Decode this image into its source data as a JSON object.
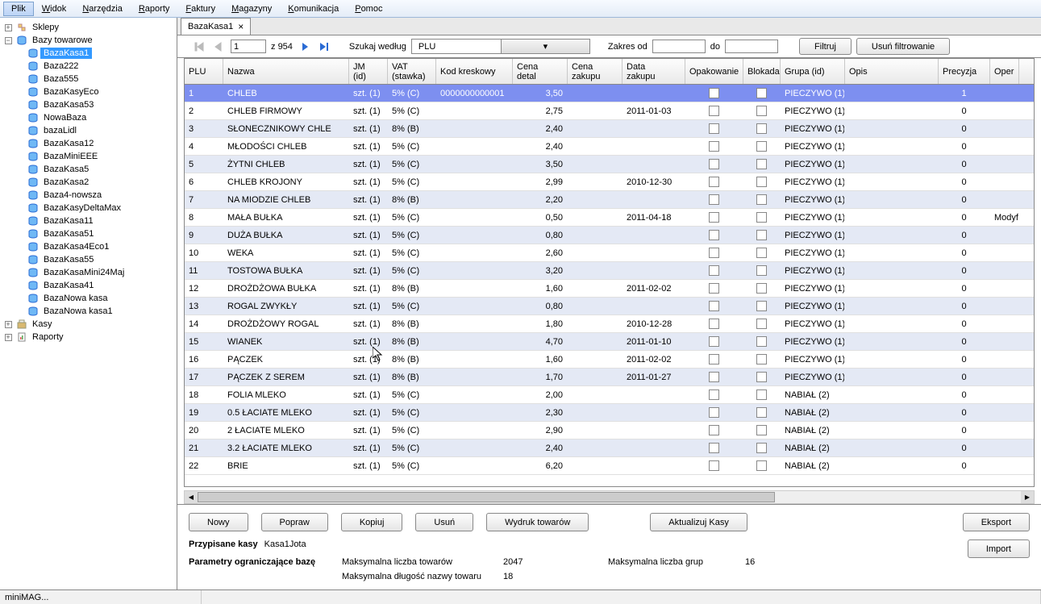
{
  "menu": [
    "Plik",
    "Widok",
    "Narzędzia",
    "Raporty",
    "Faktury",
    "Magazyny",
    "Komunikacja",
    "Pomoc"
  ],
  "tree": {
    "roots": [
      {
        "label": "Sklepy",
        "icon": "shops",
        "exp": "+"
      },
      {
        "label": "Bazy towarowe",
        "icon": "db",
        "exp": "-",
        "children": [
          "BazaKasa1",
          "Baza222",
          "Baza555",
          "BazaKasyEco",
          "BazaKasa53",
          "NowaBaza",
          "bazaLidl",
          "BazaKasa12",
          "BazaMiniEEE",
          "BazaKasa5",
          "BazaKasa2",
          "Baza4-nowsza",
          "BazaKasyDeltaMax",
          "BazaKasa11",
          "BazaKasa51",
          "BazaKasa4Eco1",
          "BazaKasa55",
          "BazaKasaMini24Maj",
          "BazaKasa41",
          "BazaNowa kasa",
          "BazaNowa kasa1"
        ],
        "selected": "BazaKasa1"
      },
      {
        "label": "Kasy",
        "icon": "register",
        "exp": "+"
      },
      {
        "label": "Raporty",
        "icon": "report",
        "exp": "+"
      }
    ]
  },
  "tab": {
    "label": "BazaKasa1"
  },
  "toolbar": {
    "page": "1",
    "of_prefix": "z",
    "of": "954",
    "search_label": "Szukaj według",
    "search_field": "PLU",
    "range_from_label": "Zakres od",
    "range_to_label": "do",
    "range_from": "",
    "range_to": "",
    "filter_btn": "Filtruj",
    "clear_btn": "Usuń filtrowanie"
  },
  "columns": [
    "PLU",
    "Nazwa",
    "JM (id)",
    "VAT (stawka)",
    "Kod kreskowy",
    "Cena detal",
    "Cena zakupu",
    "Data zakupu",
    "Opakowanie",
    "Blokada",
    "Grupa (id)",
    "Opis",
    "Precyzja",
    "Oper"
  ],
  "rows": [
    {
      "plu": "1",
      "name": "CHLEB",
      "jm": "szt. (1)",
      "vat": "5% (C)",
      "bar": "0000000000001",
      "cd": "3,50",
      "cz": "",
      "dz": "",
      "grp": "PIECZYWO (1)",
      "pr": "1",
      "op": "",
      "sel": true
    },
    {
      "plu": "2",
      "name": "CHLEB FIRMOWY",
      "jm": "szt. (1)",
      "vat": "5% (C)",
      "bar": "",
      "cd": "2,75",
      "cz": "",
      "dz": "2011-01-03",
      "grp": "PIECZYWO (1)",
      "pr": "0",
      "op": ""
    },
    {
      "plu": "3",
      "name": "SŁONECZNIKOWY CHLE",
      "jm": "szt. (1)",
      "vat": "8% (B)",
      "bar": "",
      "cd": "2,40",
      "cz": "",
      "dz": "",
      "grp": "PIECZYWO (1)",
      "pr": "0",
      "op": ""
    },
    {
      "plu": "4",
      "name": "MŁODOŚCI CHLEB",
      "jm": "szt. (1)",
      "vat": "5% (C)",
      "bar": "",
      "cd": "2,40",
      "cz": "",
      "dz": "",
      "grp": "PIECZYWO (1)",
      "pr": "0",
      "op": ""
    },
    {
      "plu": "5",
      "name": "ŻYTNI CHLEB",
      "jm": "szt. (1)",
      "vat": "5% (C)",
      "bar": "",
      "cd": "3,50",
      "cz": "",
      "dz": "",
      "grp": "PIECZYWO (1)",
      "pr": "0",
      "op": ""
    },
    {
      "plu": "6",
      "name": "CHLEB KROJONY",
      "jm": "szt. (1)",
      "vat": "5% (C)",
      "bar": "",
      "cd": "2,99",
      "cz": "",
      "dz": "2010-12-30",
      "grp": "PIECZYWO (1)",
      "pr": "0",
      "op": ""
    },
    {
      "plu": "7",
      "name": "NA MIODZIE CHLEB",
      "jm": "szt. (1)",
      "vat": "8% (B)",
      "bar": "",
      "cd": "2,20",
      "cz": "",
      "dz": "",
      "grp": "PIECZYWO (1)",
      "pr": "0",
      "op": ""
    },
    {
      "plu": "8",
      "name": "MAŁA BUŁKA",
      "jm": "szt. (1)",
      "vat": "5% (C)",
      "bar": "",
      "cd": "0,50",
      "cz": "",
      "dz": "2011-04-18",
      "grp": "PIECZYWO (1)",
      "pr": "0",
      "op": "Modyf"
    },
    {
      "plu": "9",
      "name": "DUŻA BUŁKA",
      "jm": "szt. (1)",
      "vat": "5% (C)",
      "bar": "",
      "cd": "0,80",
      "cz": "",
      "dz": "",
      "grp": "PIECZYWO (1)",
      "pr": "0",
      "op": ""
    },
    {
      "plu": "10",
      "name": "WEKA",
      "jm": "szt. (1)",
      "vat": "5% (C)",
      "bar": "",
      "cd": "2,60",
      "cz": "",
      "dz": "",
      "grp": "PIECZYWO (1)",
      "pr": "0",
      "op": ""
    },
    {
      "plu": "11",
      "name": "TOSTOWA BUŁKA",
      "jm": "szt. (1)",
      "vat": "5% (C)",
      "bar": "",
      "cd": "3,20",
      "cz": "",
      "dz": "",
      "grp": "PIECZYWO (1)",
      "pr": "0",
      "op": ""
    },
    {
      "plu": "12",
      "name": "DROŻDŻOWA BUŁKA",
      "jm": "szt. (1)",
      "vat": "8% (B)",
      "bar": "",
      "cd": "1,60",
      "cz": "",
      "dz": "2011-02-02",
      "grp": "PIECZYWO (1)",
      "pr": "0",
      "op": ""
    },
    {
      "plu": "13",
      "name": "ROGAL ZWYKŁY",
      "jm": "szt. (1)",
      "vat": "5% (C)",
      "bar": "",
      "cd": "0,80",
      "cz": "",
      "dz": "",
      "grp": "PIECZYWO (1)",
      "pr": "0",
      "op": ""
    },
    {
      "plu": "14",
      "name": "DROŻDŻOWY ROGAL",
      "jm": "szt. (1)",
      "vat": "8% (B)",
      "bar": "",
      "cd": "1,80",
      "cz": "",
      "dz": "2010-12-28",
      "grp": "PIECZYWO (1)",
      "pr": "0",
      "op": ""
    },
    {
      "plu": "15",
      "name": "WIANEK",
      "jm": "szt. (1)",
      "vat": "8% (B)",
      "bar": "",
      "cd": "4,70",
      "cz": "",
      "dz": "2011-01-10",
      "grp": "PIECZYWO (1)",
      "pr": "0",
      "op": ""
    },
    {
      "plu": "16",
      "name": "PĄCZEK",
      "jm": "szt. (1)",
      "vat": "8% (B)",
      "bar": "",
      "cd": "1,60",
      "cz": "",
      "dz": "2011-02-02",
      "grp": "PIECZYWO (1)",
      "pr": "0",
      "op": ""
    },
    {
      "plu": "17",
      "name": "PĄCZEK Z SEREM",
      "jm": "szt. (1)",
      "vat": "8% (B)",
      "bar": "",
      "cd": "1,70",
      "cz": "",
      "dz": "2011-01-27",
      "grp": "PIECZYWO (1)",
      "pr": "0",
      "op": ""
    },
    {
      "plu": "18",
      "name": "FOLIA MLEKO",
      "jm": "szt. (1)",
      "vat": "5% (C)",
      "bar": "",
      "cd": "2,00",
      "cz": "",
      "dz": "",
      "grp": "NABIAŁ (2)",
      "pr": "0",
      "op": ""
    },
    {
      "plu": "19",
      "name": "0.5 ŁACIATE MLEKO",
      "jm": "szt. (1)",
      "vat": "5% (C)",
      "bar": "",
      "cd": "2,30",
      "cz": "",
      "dz": "",
      "grp": "NABIAŁ (2)",
      "pr": "0",
      "op": ""
    },
    {
      "plu": "20",
      "name": "2 ŁACIATE MLEKO",
      "jm": "szt. (1)",
      "vat": "5% (C)",
      "bar": "",
      "cd": "2,90",
      "cz": "",
      "dz": "",
      "grp": "NABIAŁ (2)",
      "pr": "0",
      "op": ""
    },
    {
      "plu": "21",
      "name": "3.2 ŁACIATE MLEKO",
      "jm": "szt. (1)",
      "vat": "5% (C)",
      "bar": "",
      "cd": "2,40",
      "cz": "",
      "dz": "",
      "grp": "NABIAŁ (2)",
      "pr": "0",
      "op": ""
    },
    {
      "plu": "22",
      "name": "BRIE",
      "jm": "szt. (1)",
      "vat": "5% (C)",
      "bar": "",
      "cd": "6,20",
      "cz": "",
      "dz": "",
      "grp": "NABIAŁ (2)",
      "pr": "0",
      "op": ""
    }
  ],
  "buttons": {
    "nowy": "Nowy",
    "popraw": "Popraw",
    "kopiuj": "Kopiuj",
    "usun": "Usuń",
    "wydruk": "Wydruk towarów",
    "aktualizuj": "Aktualizuj Kasy",
    "eksport": "Eksport",
    "import": "Import"
  },
  "info": {
    "assigned_label": "Przypisane kasy",
    "assigned_value": "Kasa1Jota",
    "param_label": "Parametry ograniczające bazę",
    "max_items_label": "Maksymalna liczba towarów",
    "max_items": "2047",
    "max_groups_label": "Maksymalna liczba grup",
    "max_groups": "16",
    "max_name_label": "Maksymalna długość nazwy towaru",
    "max_name": "18"
  },
  "status": "miniMAG..."
}
